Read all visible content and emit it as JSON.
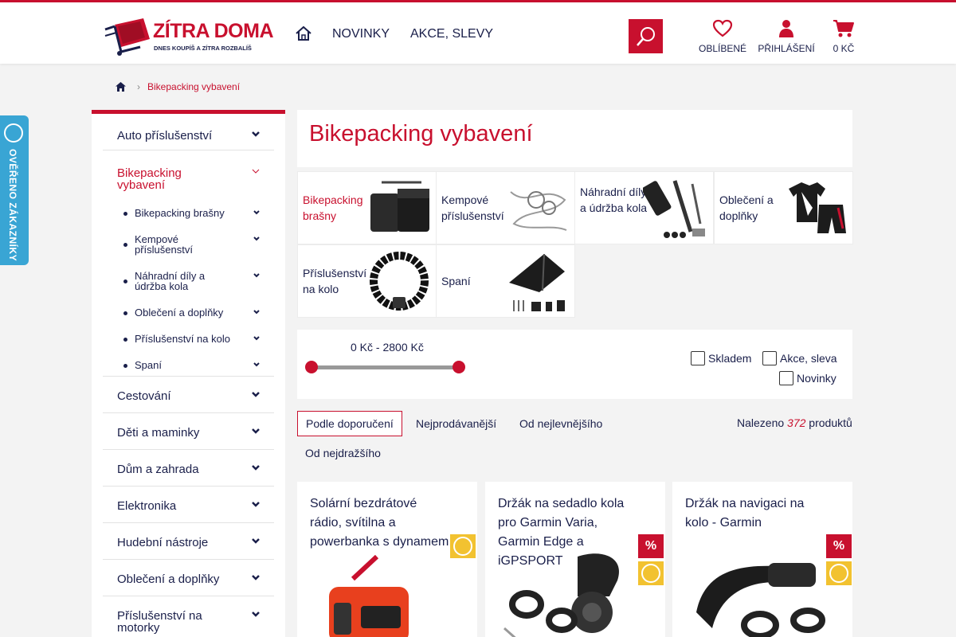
{
  "brand": {
    "name": "ZÍTRA DOMA",
    "tagline": "DNES KOUPÍŠ A ZÍTRA ROZBALÍŠ",
    "accent": "#c8102e",
    "text_color": "#1a1f4a"
  },
  "nav": {
    "home_icon": "home-icon",
    "links": [
      "NOVINKY",
      "AKCE, SLEVY"
    ]
  },
  "header_actions": {
    "favorites": "OBLÍBENÉ",
    "login": "PŘIHLÁŠENÍ",
    "cart": "0 Kč"
  },
  "verified_badge": "OVĚŘENO ZÁKAZNÍKY",
  "breadcrumb": {
    "current": "Bikepacking vybavení"
  },
  "sidebar": {
    "items": [
      {
        "label": "Auto příslušenství"
      },
      {
        "label": "Bikepacking vybavení",
        "active": true
      },
      {
        "label": "Cestování"
      },
      {
        "label": "Děti a maminky"
      },
      {
        "label": "Dům a zahrada"
      },
      {
        "label": "Elektronika"
      },
      {
        "label": "Hudební nástroje"
      },
      {
        "label": "Oblečení a doplňky"
      },
      {
        "label": "Příslušenství na motorky"
      }
    ],
    "subitems": [
      {
        "label": "Bikepacking brašny"
      },
      {
        "label": "Kempové příslušenství"
      },
      {
        "label": "Náhradní díly a údržba kola"
      },
      {
        "label": "Oblečení a doplňky"
      },
      {
        "label": "Příslušenství na kolo"
      },
      {
        "label": "Spaní"
      }
    ]
  },
  "page_title": "Bikepacking vybavení",
  "categories": [
    {
      "label": "Bikepacking brašny",
      "icon": "bike-bag-icon",
      "active": true
    },
    {
      "label": "Kempové příslušenství",
      "icon": "camping-wire-icon"
    },
    {
      "label": "Náhradní díly a údržba kola",
      "icon": "bike-tools-icon"
    },
    {
      "label": "Oblečení a doplňky",
      "icon": "cycling-jersey-icon"
    },
    {
      "label": "Příslušenství na kolo",
      "icon": "bike-lock-icon"
    },
    {
      "label": "Spaní",
      "icon": "tarp-tent-icon"
    }
  ],
  "filter": {
    "price_range": "0 Kč - 2800 Kč",
    "price_min_fraction": 0,
    "price_max_fraction": 1,
    "checkboxes": {
      "stock": "Skladem",
      "sale": "Akce, sleva",
      "new": "Novinky"
    }
  },
  "sort": {
    "options": [
      "Podle doporučení",
      "Nejprodávanější",
      "Od nejlevnějšího",
      "Od nejdražšího"
    ],
    "selected": "Podle doporučení"
  },
  "results": {
    "prefix": "Nalezeno",
    "count": "372",
    "suffix": "produktů"
  },
  "products": [
    {
      "name": "Solární bezdrátové rádio, svítilna a powerbanka s dynamem",
      "discount": false,
      "verified": true
    },
    {
      "name": "Držák na sedadlo kola pro Garmin Varia, Garmin Edge a iGPSPORT",
      "discount": true,
      "discount_symbol": "%",
      "verified": true
    },
    {
      "name": "Držák na navigaci na kolo - Garmin",
      "discount": true,
      "discount_symbol": "%",
      "verified": true
    }
  ]
}
